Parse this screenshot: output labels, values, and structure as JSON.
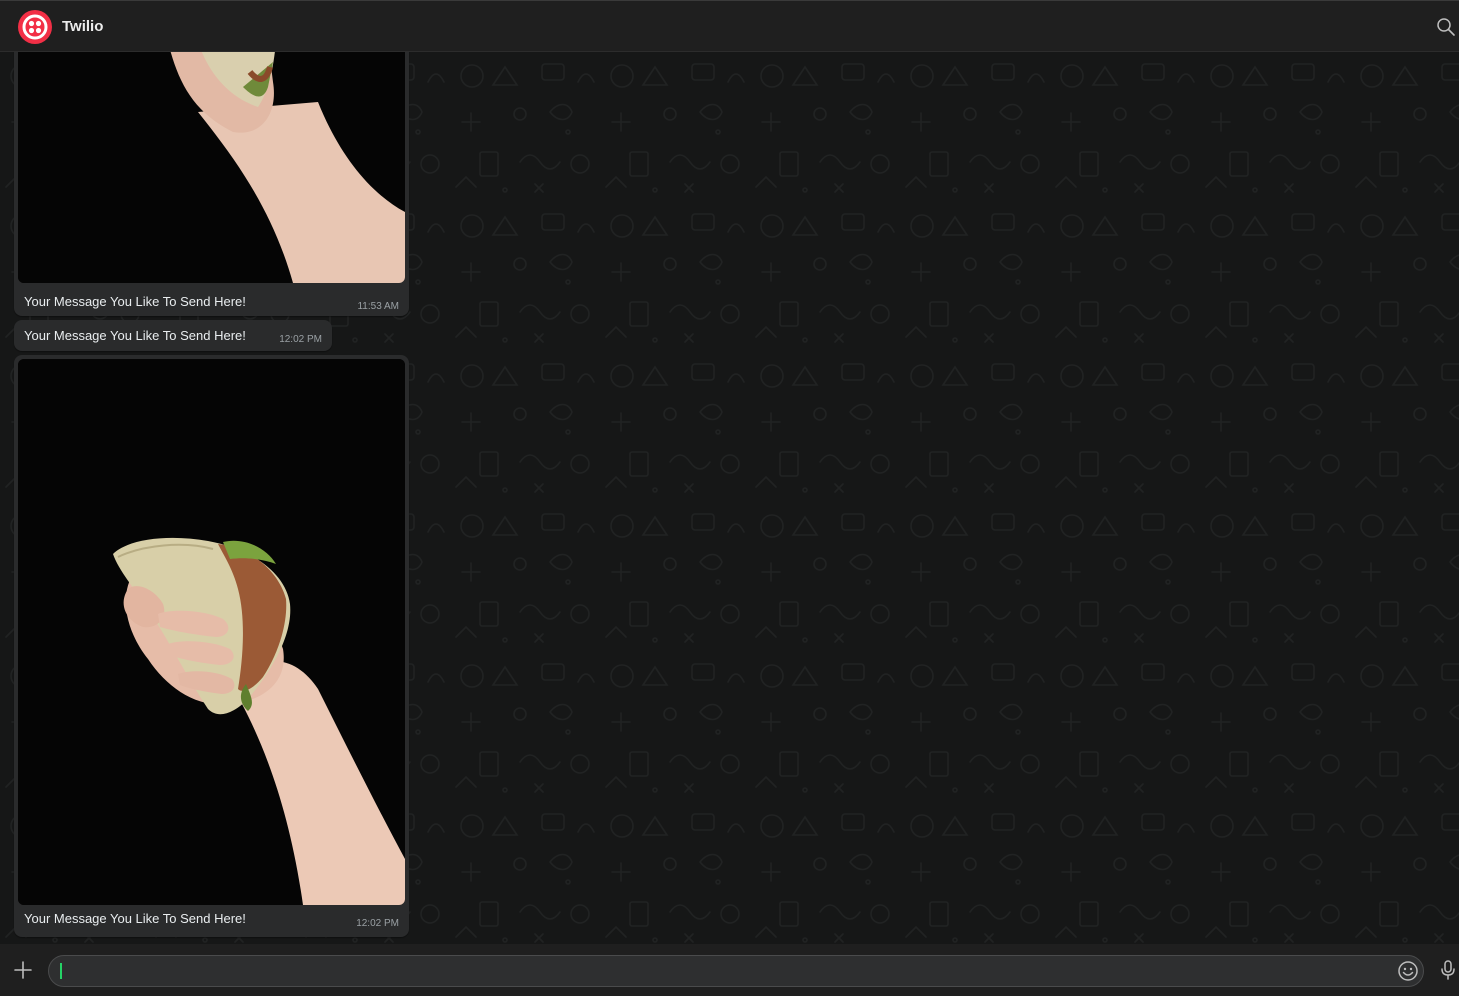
{
  "header": {
    "title": "Twilio",
    "avatar_color": "#f22f46",
    "avatar_icon": "twilio-logo-icon",
    "search_icon": "search-icon"
  },
  "messages": [
    {
      "type": "media",
      "image_description": "hand holding a taco on black background",
      "text": "Your Message You Like To Send Here!",
      "time": "11:53 AM"
    },
    {
      "type": "text",
      "text": "Your Message You Like To Send Here!",
      "time": "12:02 PM"
    },
    {
      "type": "media",
      "image_description": "hand holding a taco on black background",
      "text": "Your Message You Like To Send Here!",
      "time": "12:02 PM"
    }
  ],
  "composer": {
    "input_value": "",
    "input_placeholder": "",
    "add_icon": "plus-icon",
    "emoji_icon": "smiley-icon",
    "mic_icon": "microphone-icon"
  },
  "colors": {
    "background": "#161717",
    "bubble": "#2a2b2c",
    "header": "#1f1f1f",
    "caret": "#25d366"
  }
}
